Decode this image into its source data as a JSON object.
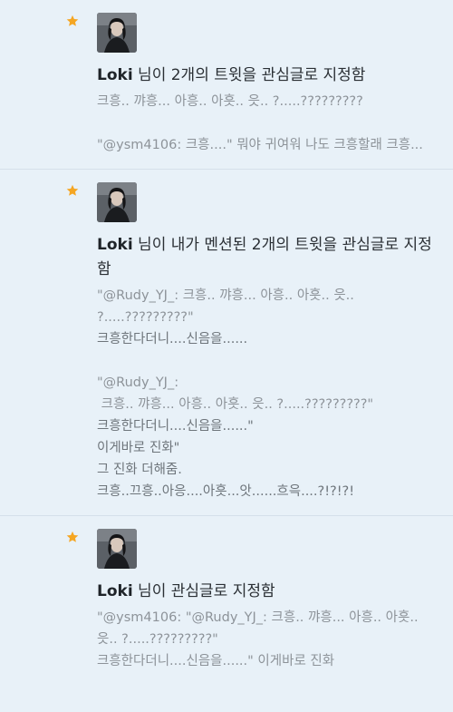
{
  "colors": {
    "background": "#e8f1f8",
    "divider": "#d5e0ea",
    "star": "#f5a623",
    "name": "#1e2328",
    "quote_text": "#8d9399"
  },
  "items": [
    {
      "icon": "star-icon",
      "user_name": "Loki",
      "action_text": " 님이 2개의 트윗을 관심글로 지정함",
      "lines": [
        "크흥.. 꺄흥... 아흥.. 아흣.. 읏.. ?.....?????????",
        "",
        "\"@ysm4106: 크흥....\" 뭐야 귀여워 나도 크흥할래 크흥..."
      ]
    },
    {
      "icon": "star-icon",
      "user_name": "Loki",
      "action_text": " 님이 내가 멘션된 2개의 트윗을 관심글로 지정함",
      "lines": [
        "\"@Rudy_YJ_: 크흥.. 꺄흥... 아흥.. 아흣.. 읏.. ?.....?????????\"",
        "크흥한다더니....신음을......",
        "",
        "\"@Rudy_YJ_:",
        " 크흥.. 꺄흥... 아흥.. 아흣.. 읏.. ?.....?????????\"",
        "크흥한다더니....신음을......\"",
        "이게바로 진화\"",
        "그 진화 더해줌.",
        "크흥..끄흥..아응....아흣...앗......흐윽....?!?!?!"
      ]
    },
    {
      "icon": "star-icon",
      "user_name": "Loki",
      "action_text": " 님이 관심글로 지정함",
      "lines": [
        "\"@ysm4106: \"@Rudy_YJ_: 크흥.. 꺄흥... 아흥.. 아흣.. 읏.. ?.....?????????\"",
        "크흥한다더니....신음을......\" 이게바로 진화"
      ]
    }
  ]
}
